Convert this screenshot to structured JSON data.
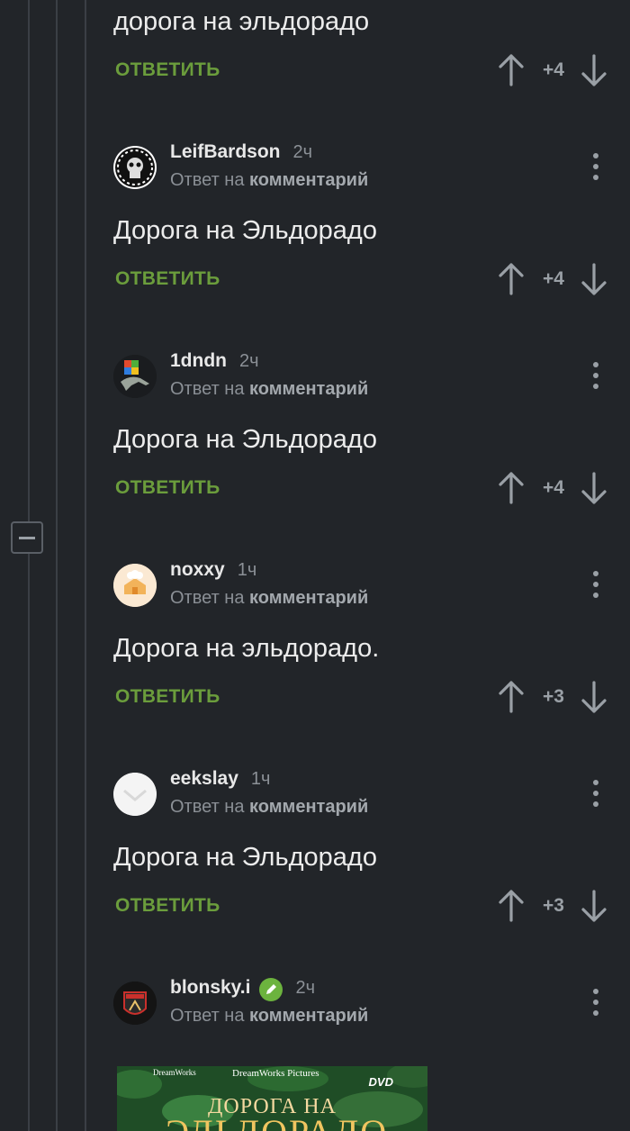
{
  "first_comment": {
    "text": "дорога на эльдорадо",
    "reply_label": "ОТВЕТИТЬ",
    "score": "+4"
  },
  "comments": [
    {
      "username": "LeifBardson",
      "time": "2ч",
      "reply_to_prefix": "Ответ на",
      "reply_to_link": "комментарий",
      "text": "Дорога на Эльдорадо",
      "reply_label": "ОТВЕТИТЬ",
      "score": "+4"
    },
    {
      "username": "1dndn",
      "time": "2ч",
      "reply_to_prefix": "Ответ на",
      "reply_to_link": "комментарий",
      "text": "Дорога на Эльдорадо",
      "reply_label": "ОТВЕТИТЬ",
      "score": "+4"
    },
    {
      "username": "noxxy",
      "time": "1ч",
      "reply_to_prefix": "Ответ на",
      "reply_to_link": "комментарий",
      "text": "Дорога на эльдорадо.",
      "reply_label": "ОТВЕТИТЬ",
      "score": "+3"
    },
    {
      "username": "eekslay",
      "time": "1ч",
      "reply_to_prefix": "Ответ на",
      "reply_to_link": "комментарий",
      "text": "Дорога на Эльдорадо",
      "reply_label": "ОТВЕТИТЬ",
      "score": "+3"
    },
    {
      "username": "blonsky.i",
      "time": "2ч",
      "reply_to_prefix": "Ответ на",
      "reply_to_link": "комментарий",
      "badge_icon": "pencil-icon"
    }
  ],
  "post_image": {
    "brand_left": "DreamWorks",
    "brand_right": "DreamWorks Pictures",
    "dvd_label": "DVD",
    "title_line1": "ДОРОГА НА",
    "title_line2": "ЭЛЬДОРАДО"
  },
  "colors": {
    "background": "#222529",
    "accent_green": "#6b9d3c",
    "badge_green": "#6cb33e",
    "muted": "#8b9096"
  },
  "icons": {
    "upvote": "arrow-up-icon",
    "downvote": "arrow-down-icon",
    "menu": "more-vertical-icon",
    "collapse": "minus-icon"
  }
}
